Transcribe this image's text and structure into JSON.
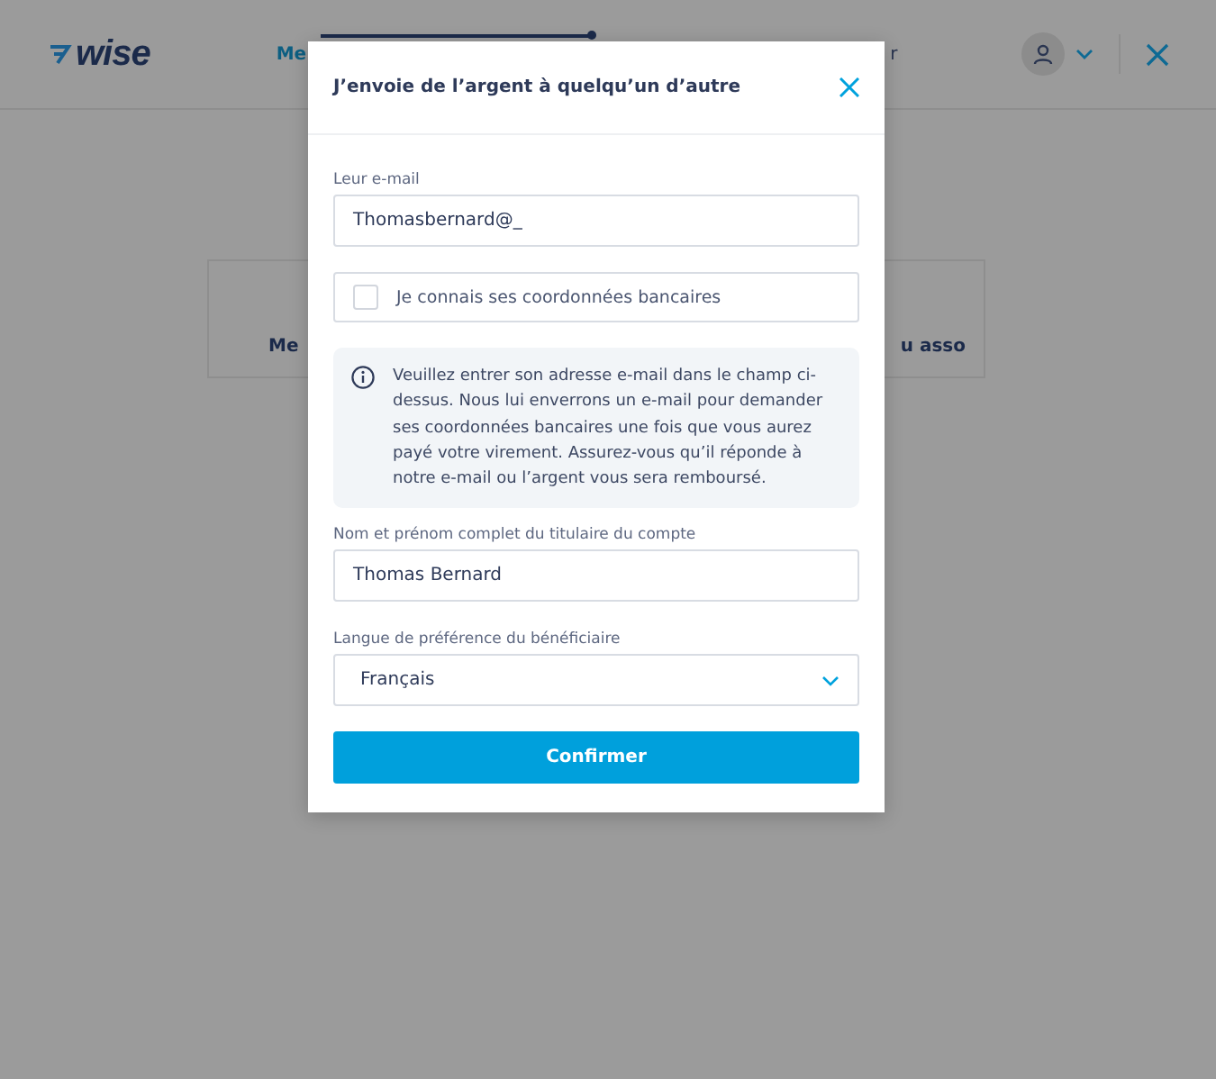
{
  "page": {
    "logo": "wise",
    "nav_left": "Me",
    "nav_right": "r",
    "progress": {
      "level": 0.98
    },
    "card_left": "Me",
    "card_right": "u asso"
  },
  "dialog": {
    "title": "J’envoie de l’argent à quelqu’un d’autre",
    "email": {
      "label": "Leur e-mail",
      "value": "Thomasbernard@_"
    },
    "bank_details": {
      "label": "Je connais ses coordonnées bancaires",
      "checked": false
    },
    "info": "Veuillez entrer son adresse e-mail dans le champ ci-dessus. Nous lui enverrons un e-mail pour demander ses coordonnées bancaires une fois que vous aurez payé votre virement. Assurez-vous qu’il réponde à notre e-mail ou l’argent vous sera remboursé.",
    "name": {
      "label": "Nom et prénom complet du titulaire du compte",
      "value": "Thomas Bernard"
    },
    "language": {
      "label": "Langue de préférence du bénéficiaire",
      "value": "Français"
    },
    "confirm": "Confirmer"
  }
}
